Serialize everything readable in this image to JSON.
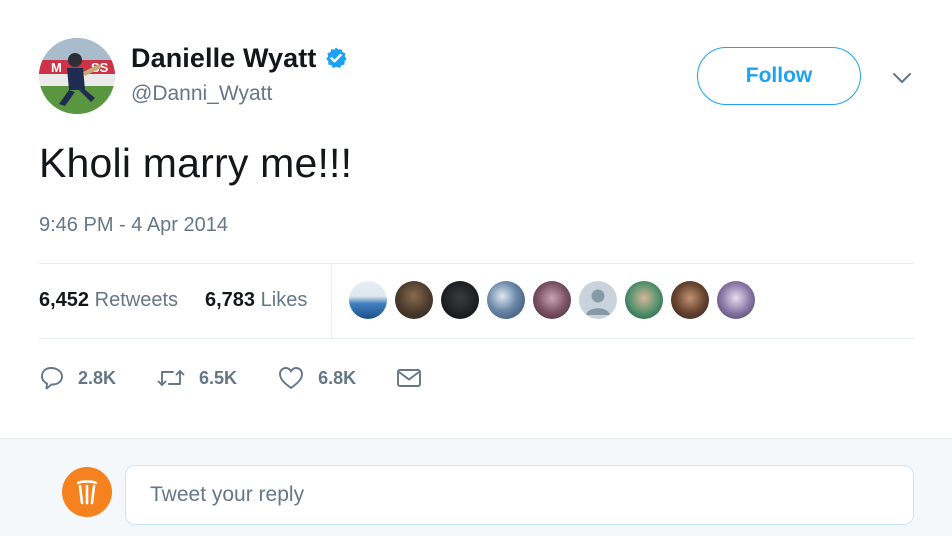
{
  "tweet": {
    "author": {
      "display_name": "Danielle Wyatt",
      "handle": "@Danni_Wyatt",
      "verified": true,
      "avatar_icon": "profile-photo-cricketer"
    },
    "follow_label": "Follow",
    "text": "Kholi marry me!!!",
    "timestamp": "9:46 PM - 4 Apr 2014",
    "stats": {
      "retweets_count": "6,452",
      "retweets_label": "Retweets",
      "likes_count": "6,783",
      "likes_label": "Likes"
    },
    "liker_avatars": [
      "liker-avatar-1",
      "liker-avatar-2",
      "liker-avatar-3",
      "liker-avatar-4",
      "liker-avatar-5",
      "liker-avatar-6",
      "liker-avatar-7",
      "liker-avatar-8",
      "liker-avatar-9"
    ],
    "actions": {
      "replies": "2.8K",
      "retweets": "6.5K",
      "likes": "6.8K"
    }
  },
  "reply": {
    "placeholder": "Tweet your reply",
    "avatar_icon": "cricket-wicket-logo"
  },
  "colors": {
    "accent": "#1da1f2",
    "text": "#14171a",
    "muted": "#657786",
    "divider": "#e6ecf0",
    "reply_avatar_bg": "#f5821f"
  }
}
